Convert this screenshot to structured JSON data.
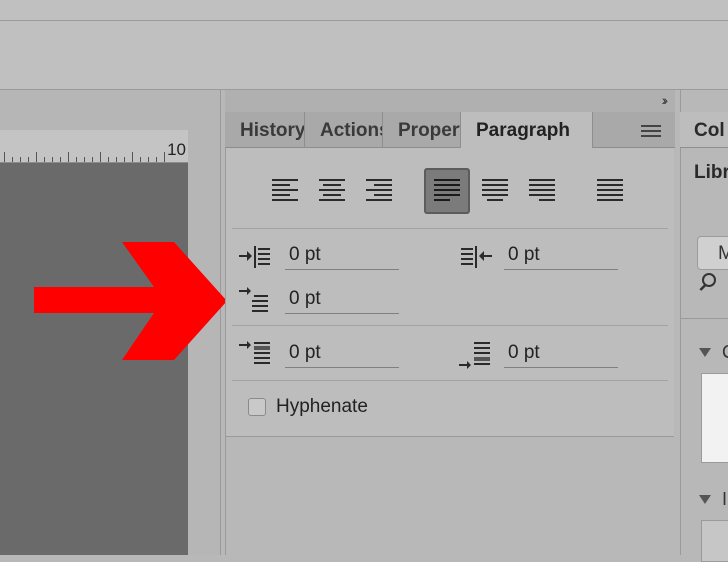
{
  "colors": {
    "arrow": "#ff0000",
    "canvas": "#6a6a6a",
    "selected_button": "#7b7b7b"
  },
  "ruler": {
    "label": "10"
  },
  "dock": {
    "collapse_icon": "double-chevron-right-icon"
  },
  "tabs": [
    {
      "label": "History",
      "active": false
    },
    {
      "label": "Actions",
      "active": false
    },
    {
      "label": "Properties",
      "active": false
    },
    {
      "label": "Paragraph",
      "active": true
    }
  ],
  "paragraph": {
    "alignment_buttons": [
      {
        "name": "align-left-icon",
        "selected": false
      },
      {
        "name": "align-center-icon",
        "selected": false
      },
      {
        "name": "align-right-icon",
        "selected": false
      },
      {
        "name": "justify-last-left-icon",
        "selected": true
      },
      {
        "name": "justify-last-center-icon",
        "selected": false
      },
      {
        "name": "justify-last-right-icon",
        "selected": false
      },
      {
        "name": "justify-all-icon",
        "selected": false
      }
    ],
    "indent_left": "0 pt",
    "indent_right": "0 pt",
    "indent_first_line": "0 pt",
    "space_before": "0 pt",
    "space_after": "0 pt",
    "hyphenate_label": "Hyphenate",
    "hyphenate_checked": false
  },
  "right_panel": {
    "tab_label": "Col",
    "libraries_label": "Libr",
    "button_label": "M",
    "search_icon": "search-icon",
    "section1_label": "C",
    "section2_label": "I"
  }
}
